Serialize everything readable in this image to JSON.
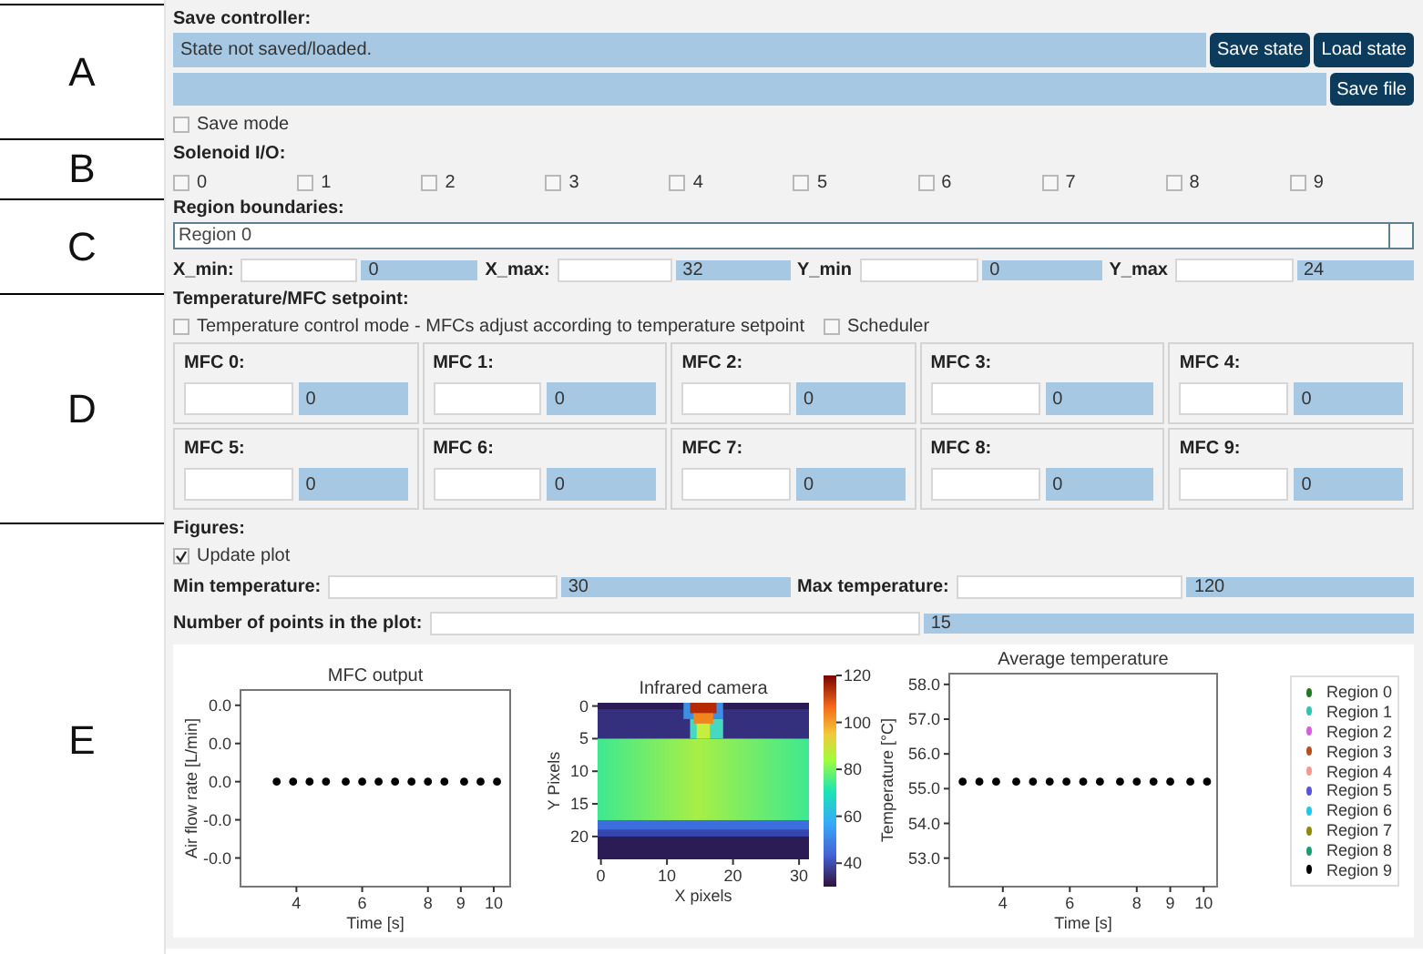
{
  "side_labels": [
    "A",
    "B",
    "C",
    "D",
    "E"
  ],
  "save_controller": {
    "title": "Save controller:",
    "status": "State not saved/loaded.",
    "buttons": [
      "Save state",
      "Load state"
    ],
    "save_file_button": "Save file",
    "save_mode": {
      "label": "Save mode",
      "checked": false
    }
  },
  "solenoid_io": {
    "title": "Solenoid I/O:",
    "valves": [
      {
        "label": "0",
        "checked": false
      },
      {
        "label": "1",
        "checked": false
      },
      {
        "label": "2",
        "checked": false
      },
      {
        "label": "3",
        "checked": false
      },
      {
        "label": "4",
        "checked": false
      },
      {
        "label": "5",
        "checked": false
      },
      {
        "label": "6",
        "checked": false
      },
      {
        "label": "7",
        "checked": false
      },
      {
        "label": "8",
        "checked": false
      },
      {
        "label": "9",
        "checked": false
      }
    ]
  },
  "region_boundaries": {
    "title": "Region boundaries:",
    "region_select": "Region 0",
    "bounds": [
      {
        "label": "X_min:",
        "value": "0"
      },
      {
        "label": "X_max:",
        "value": "32"
      },
      {
        "label": "Y_min",
        "value": "0"
      },
      {
        "label": "Y_max",
        "value": "24"
      }
    ]
  },
  "setpoint": {
    "title": "Temperature/MFC setpoint:",
    "options": [
      {
        "label": "Temperature control mode - MFCs adjust according to temperature setpoint",
        "checked": false
      },
      {
        "label": "Scheduler",
        "checked": false
      }
    ],
    "mfcs": [
      {
        "label": "MFC 0:",
        "value": "0"
      },
      {
        "label": "MFC 1:",
        "value": "0"
      },
      {
        "label": "MFC 2:",
        "value": "0"
      },
      {
        "label": "MFC 3:",
        "value": "0"
      },
      {
        "label": "MFC 4:",
        "value": "0"
      },
      {
        "label": "MFC 5:",
        "value": "0"
      },
      {
        "label": "MFC 6:",
        "value": "0"
      },
      {
        "label": "MFC 7:",
        "value": "0"
      },
      {
        "label": "MFC 8:",
        "value": "0"
      },
      {
        "label": "MFC 9:",
        "value": "0"
      }
    ]
  },
  "figures": {
    "title": "Figures:",
    "update_plot": {
      "label": "Update plot",
      "checked": true
    },
    "limits": [
      {
        "label": "Min temperature:",
        "value": "30"
      },
      {
        "label": "Max temperature:",
        "value": "120"
      }
    ],
    "points": {
      "label": "Number of points in the plot:",
      "value": "15"
    },
    "mfc_output": {
      "chart_data": {
        "type": "scatter",
        "title": "MFC output",
        "xlabel": "Time [s]",
        "ylabel": "Air flow rate [L/min]",
        "x": [
          3.4,
          3.9,
          4.4,
          4.9,
          5.5,
          6.0,
          6.5,
          7.0,
          7.5,
          8.0,
          8.5,
          9.1,
          9.6,
          10.1
        ],
        "series": [
          {
            "color": "#000000",
            "values": [
              0,
              0,
              0,
              0,
              0,
              0,
              0,
              0,
              0,
              0,
              0,
              0,
              0,
              0
            ]
          }
        ],
        "xlim": [
          2.3,
          10.5
        ],
        "ylim": [
          -0.0275,
          0.024
        ],
        "xticks": [
          4,
          6,
          8,
          9,
          10
        ],
        "yticks": [
          {
            "value": 0.02,
            "label": "0.0"
          },
          {
            "value": 0.01,
            "label": "0.0"
          },
          {
            "value": 0,
            "label": "0.0"
          },
          {
            "value": -0.01,
            "label": "-0.0"
          },
          {
            "value": -0.02,
            "label": "-0.0"
          }
        ]
      }
    },
    "infrared_camera": {
      "title": "Infrared camera",
      "xlabel": "X pixels",
      "ylabel": "Y Pixels",
      "xticks": [
        "0",
        "10",
        "20",
        "30"
      ],
      "yticks": [
        "0",
        "5",
        "10",
        "15",
        "20"
      ],
      "colorbar_ticks": [
        "120",
        "100",
        "80",
        "60",
        "40"
      ]
    },
    "average_temperature": {
      "chart_data": {
        "type": "scatter",
        "title": "Average temperature",
        "xlabel": "Time [s]",
        "ylabel": "Temperature [°C]",
        "x": [
          2.8,
          3.3,
          3.8,
          4.4,
          4.9,
          5.4,
          5.9,
          6.4,
          6.9,
          7.5,
          8.0,
          8.5,
          9.0,
          9.6,
          10.1
        ],
        "series": [
          {
            "color": "#000000",
            "values": [
              55.2,
              55.2,
              55.2,
              55.2,
              55.2,
              55.2,
              55.2,
              55.2,
              55.2,
              55.2,
              55.2,
              55.2,
              55.2,
              55.2,
              55.2
            ]
          }
        ],
        "xlim": [
          2.4,
          10.4
        ],
        "ylim": [
          52.18,
          58.31
        ],
        "xticks": [
          4,
          6,
          8,
          9,
          10
        ],
        "yticks": [
          {
            "value": 58,
            "label": "58.0"
          },
          {
            "value": 57,
            "label": "57.0"
          },
          {
            "value": 56,
            "label": "56.0"
          },
          {
            "value": 55,
            "label": "55.0"
          },
          {
            "value": 54,
            "label": "54.0"
          },
          {
            "value": 53,
            "label": "53.0"
          }
        ]
      }
    },
    "legend": [
      {
        "name": "Region 0",
        "color": "#1f7a1f"
      },
      {
        "name": "Region 1",
        "color": "#2ec4b0"
      },
      {
        "name": "Region 2",
        "color": "#d45fe0"
      },
      {
        "name": "Region 3",
        "color": "#b5501a"
      },
      {
        "name": "Region 4",
        "color": "#f59a8a"
      },
      {
        "name": "Region 5",
        "color": "#5a52d8"
      },
      {
        "name": "Region 6",
        "color": "#1fc8e8"
      },
      {
        "name": "Region 7",
        "color": "#8a8a10"
      },
      {
        "name": "Region 8",
        "color": "#16a070"
      },
      {
        "name": "Region 9",
        "color": "#000000"
      }
    ]
  }
}
